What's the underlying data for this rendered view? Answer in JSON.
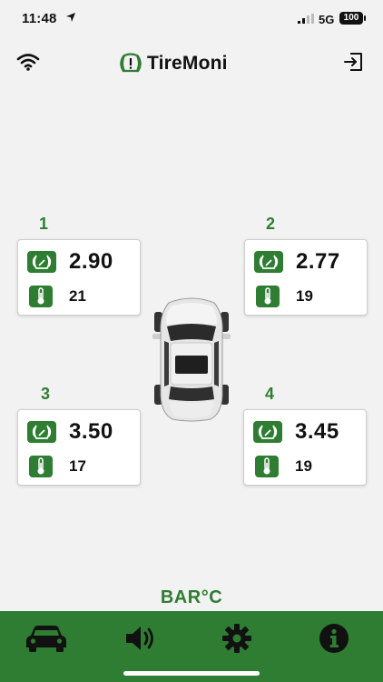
{
  "status_bar": {
    "time": "11:48",
    "network": "5G",
    "battery": "100"
  },
  "app": {
    "name": "TireMoni"
  },
  "tires": [
    {
      "id": "1",
      "pressure": "2.90",
      "temperature": "21"
    },
    {
      "id": "2",
      "pressure": "2.77",
      "temperature": "19"
    },
    {
      "id": "3",
      "pressure": "3.50",
      "temperature": "17"
    },
    {
      "id": "4",
      "pressure": "3.45",
      "temperature": "19"
    }
  ],
  "units_label": "BAR°C",
  "nav": {
    "items": [
      {
        "icon": "car-icon"
      },
      {
        "icon": "speaker-icon"
      },
      {
        "icon": "gear-icon"
      },
      {
        "icon": "info-icon"
      }
    ]
  },
  "colors": {
    "brand_green": "#2e7d32",
    "background": "#f2f2f2"
  }
}
